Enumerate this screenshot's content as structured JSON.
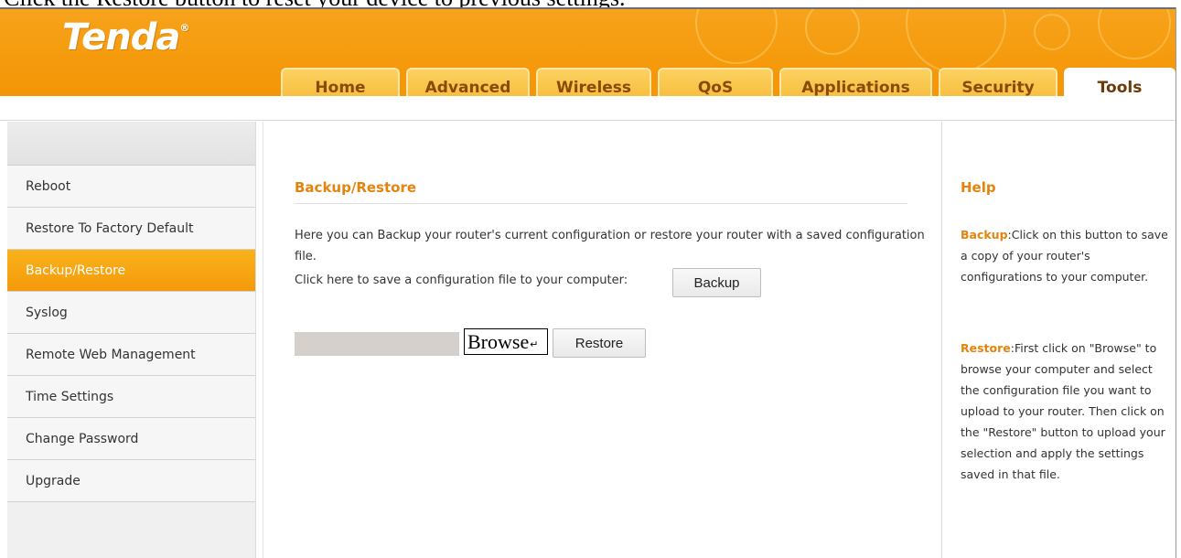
{
  "doc_caption": "Click the Restore button to reset your device to previous settings.",
  "brand": {
    "logo_text": "Tenda",
    "logo_mark": "®"
  },
  "nav": {
    "tabs": [
      {
        "label": "Home"
      },
      {
        "label": "Advanced"
      },
      {
        "label": "Wireless"
      },
      {
        "label": "QoS"
      },
      {
        "label": "Applications"
      },
      {
        "label": "Security"
      },
      {
        "label": "Tools"
      }
    ],
    "active_tab": "Tools"
  },
  "sidebar": {
    "items": [
      {
        "label": "Reboot"
      },
      {
        "label": "Restore To Factory Default"
      },
      {
        "label": "Backup/Restore"
      },
      {
        "label": "Syslog"
      },
      {
        "label": "Remote Web Management"
      },
      {
        "label": "Time Settings"
      },
      {
        "label": "Change Password"
      },
      {
        "label": "Upgrade"
      }
    ],
    "active_item": "Backup/Restore"
  },
  "main": {
    "title": "Backup/Restore",
    "description": "Here you can Backup your router's current configuration or restore your router with a saved configuration file.",
    "backup_prompt": "Click here to save a configuration file to your computer:",
    "backup_button": "Backup",
    "file_input_value": "",
    "browse_button": "Browse",
    "browse_mark": "↵",
    "restore_button": "Restore"
  },
  "help": {
    "title": "Help",
    "backup_term": "Backup",
    "backup_text": ":Click on this button to save a copy of your router's configurations to your computer.",
    "restore_term": "Restore",
    "restore_text": ":First click on \"Browse\" to browse your computer and select the configuration file you want to upload to your router. Then click on the \"Restore\" button to  upload your selection and apply the settings saved in that file."
  },
  "colors": {
    "brand_orange": "#f59a0c",
    "accent_text": "#e4830d",
    "tab_yellow": "#f6b936"
  }
}
